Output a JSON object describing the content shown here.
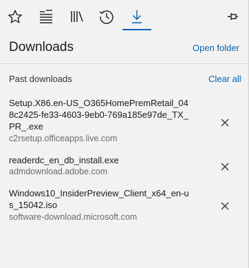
{
  "toolbar": {
    "icons": [
      "favorites-star-icon",
      "reading-list-icon",
      "books-icon",
      "history-icon",
      "downloads-icon",
      "pin-icon"
    ],
    "active": "downloads-icon",
    "accent": "#0063b1"
  },
  "panel": {
    "title": "Downloads",
    "open_folder": "Open folder",
    "section_label": "Past downloads",
    "clear_all": "Clear all"
  },
  "downloads": [
    {
      "name": "Setup.X86.en-US_O365HomePremRetail_048c2425-fe33-4603-9eb0-769a185e97de_TX_PR_.exe",
      "source": "c2rsetup.officeapps.live.com"
    },
    {
      "name": "readerdc_en_db_install.exe",
      "source": "admdownload.adobe.com"
    },
    {
      "name": "Windows10_InsiderPreview_Client_x64_en-us_15042.iso",
      "source": "software-download.microsoft.com"
    }
  ]
}
